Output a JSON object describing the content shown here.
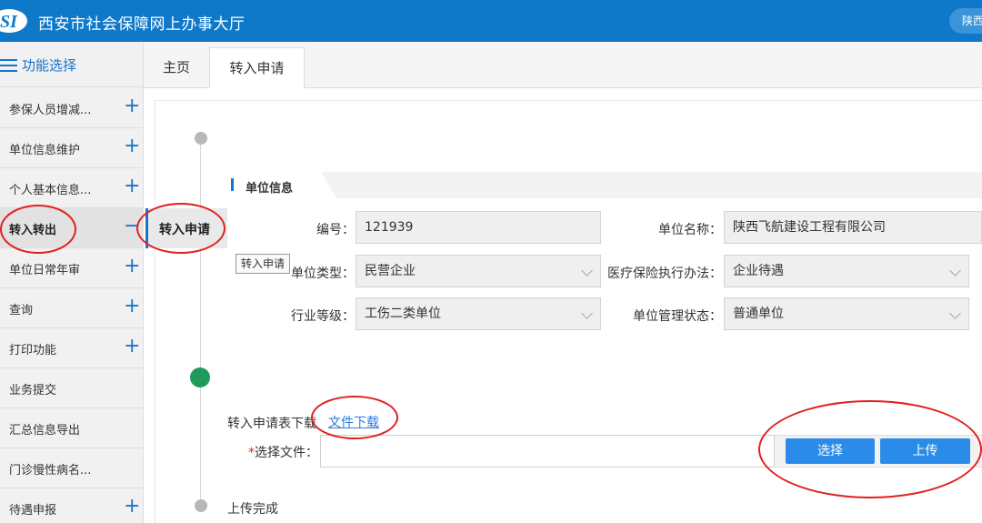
{
  "header": {
    "title": "西安市社会保障网上办事大厅",
    "region": "陕西"
  },
  "sidebar": {
    "heading": "功能选择",
    "items": [
      {
        "label": "参保人员增减...",
        "sign": "+"
      },
      {
        "label": "单位信息维护",
        "sign": "+"
      },
      {
        "label": "个人基本信息...",
        "sign": "+"
      },
      {
        "label": "转入转出",
        "sign": "−"
      },
      {
        "label": "单位日常年审",
        "sign": "+"
      },
      {
        "label": "查询",
        "sign": "+"
      },
      {
        "label": "打印功能",
        "sign": "+"
      },
      {
        "label": "业务提交",
        "sign": ""
      },
      {
        "label": "汇总信息导出",
        "sign": ""
      },
      {
        "label": "门诊慢性病名...",
        "sign": ""
      },
      {
        "label": "待遇申报",
        "sign": "+"
      }
    ]
  },
  "tabs": [
    {
      "label": "主页"
    },
    {
      "label": "转入申请"
    }
  ],
  "step": {
    "current_label": "转入申请",
    "tooltip": "转入申请",
    "last_label": "上传完成"
  },
  "unit_section": {
    "title": "单位信息",
    "fields": {
      "unit_no": {
        "label": "编号：",
        "value": "121939"
      },
      "unit_name": {
        "label": "单位名称：",
        "value": "陕西飞航建设工程有限公司"
      },
      "unit_type": {
        "label": "单位类型：",
        "value": "民营企业"
      },
      "medical_method": {
        "label": "医疗保险执行办法：",
        "value": "企业待遇"
      },
      "industry_level": {
        "label": "行业等级：",
        "value": "工伤二类单位"
      },
      "mgmt_status": {
        "label": "单位管理状态：",
        "value": "普通单位"
      }
    }
  },
  "upload": {
    "download_label": "转入申请表下载",
    "download_link": "文件下载",
    "required_mark": "*",
    "file_label": "选择文件：",
    "file_value": "",
    "choose_button": "选择",
    "upload_button": "上传"
  },
  "colors": {
    "header_blue": "#0f78c9",
    "accent_blue": "#1a74c9",
    "button_blue": "#2a8ce8",
    "annotation_red": "#e02020",
    "step_green": "#1e9a5a"
  }
}
